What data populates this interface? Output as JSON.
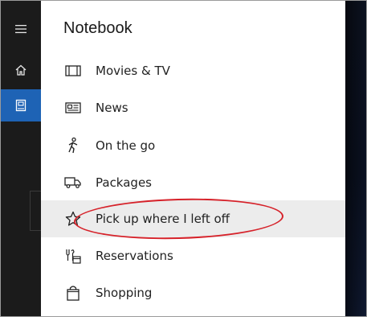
{
  "panel": {
    "title": "Notebook"
  },
  "rail": {
    "items": [
      {
        "icon": "hamburger-menu-icon"
      },
      {
        "icon": "home-icon"
      },
      {
        "icon": "notebook-icon",
        "active": true
      }
    ],
    "active_color": "#1e63b5"
  },
  "items": [
    {
      "label": "Movies & TV",
      "icon": "film-icon"
    },
    {
      "label": "News",
      "icon": "newspaper-icon"
    },
    {
      "label": "On the go",
      "icon": "walking-icon"
    },
    {
      "label": "Packages",
      "icon": "truck-icon"
    },
    {
      "label": "Pick up where I left off",
      "icon": "star-icon",
      "highlighted": true
    },
    {
      "label": "Reservations",
      "icon": "reservations-icon"
    },
    {
      "label": "Shopping",
      "icon": "shopping-bag-icon"
    }
  ],
  "annotation": {
    "shape": "ellipse",
    "color": "#d6222a"
  }
}
